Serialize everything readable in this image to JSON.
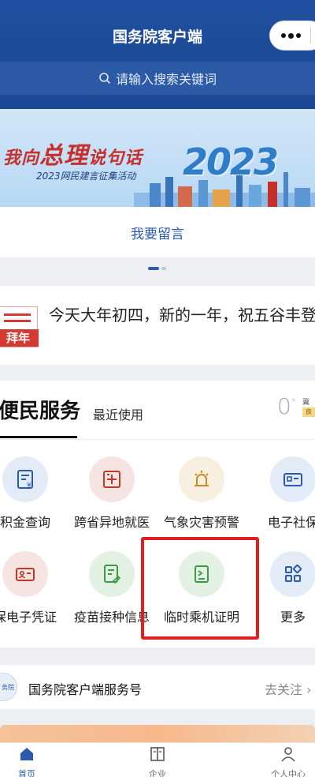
{
  "header": {
    "title": "国务院客户端"
  },
  "search": {
    "placeholder": "请输入搜索关键词"
  },
  "banner": {
    "headline_a": "我向",
    "headline_b": "总理",
    "headline_c": "说句话",
    "subtitle": "2023网民建言征集活动",
    "year": "2023"
  },
  "leave_message": {
    "label": "我要留言"
  },
  "notice": {
    "badge": "拜年",
    "text": "今天大年初四，新的一年，祝五谷丰登!"
  },
  "services": {
    "tab_main": "便民服务",
    "tab_recent": "最近使用",
    "weather": {
      "temp": "0",
      "unit": "°",
      "city": "冀州",
      "aqi": "良"
    },
    "items": [
      {
        "label": "积金查询"
      },
      {
        "label": "跨省异地就医"
      },
      {
        "label": "气象灾害预警"
      },
      {
        "label": "电子社保"
      },
      {
        "label": "保电子凭证"
      },
      {
        "label": "疫苗接种信息"
      },
      {
        "label": "临时乘机证明"
      },
      {
        "label": "更多"
      }
    ]
  },
  "follow": {
    "logo_text": "务院",
    "name": "国务院客户端服务号",
    "button": "去关注"
  },
  "tabbar": {
    "items": [
      {
        "label": "首页"
      },
      {
        "label": "企业"
      },
      {
        "label": "个人中心"
      }
    ]
  },
  "colors": {
    "primary": "#2b5bb0",
    "header": "#1f4f9e",
    "highlight": "#e02020"
  }
}
